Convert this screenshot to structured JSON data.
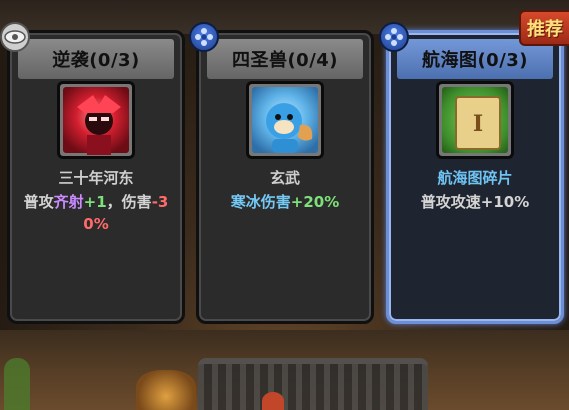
{
  "recommend_badge": "推荐",
  "cards": [
    {
      "title": "逆袭(0/3)",
      "name": "三十年河东",
      "desc_parts": [
        "普攻",
        "齐射",
        "+1",
        "，伤害",
        "-3",
        "0%"
      ],
      "corner_icon": "eye-icon",
      "selected": false
    },
    {
      "title": "四圣兽(0/4)",
      "name": "玄武",
      "desc_parts": [
        "寒冰伤害",
        "+20%"
      ],
      "corner_icon": "snowflake-flower-icon",
      "selected": false
    },
    {
      "title": "航海图(0/3)",
      "name": "航海图碎片",
      "desc_parts": [
        "普攻攻速+10%"
      ],
      "corner_icon": "snowflake-flower-icon",
      "selected": true
    }
  ],
  "colors": {
    "selected_border": "#6d8fd6",
    "highlight_purple": "#c98bff",
    "highlight_green": "#7ee07a",
    "highlight_red": "#ff6a6a",
    "highlight_blue": "#74c9f5"
  }
}
